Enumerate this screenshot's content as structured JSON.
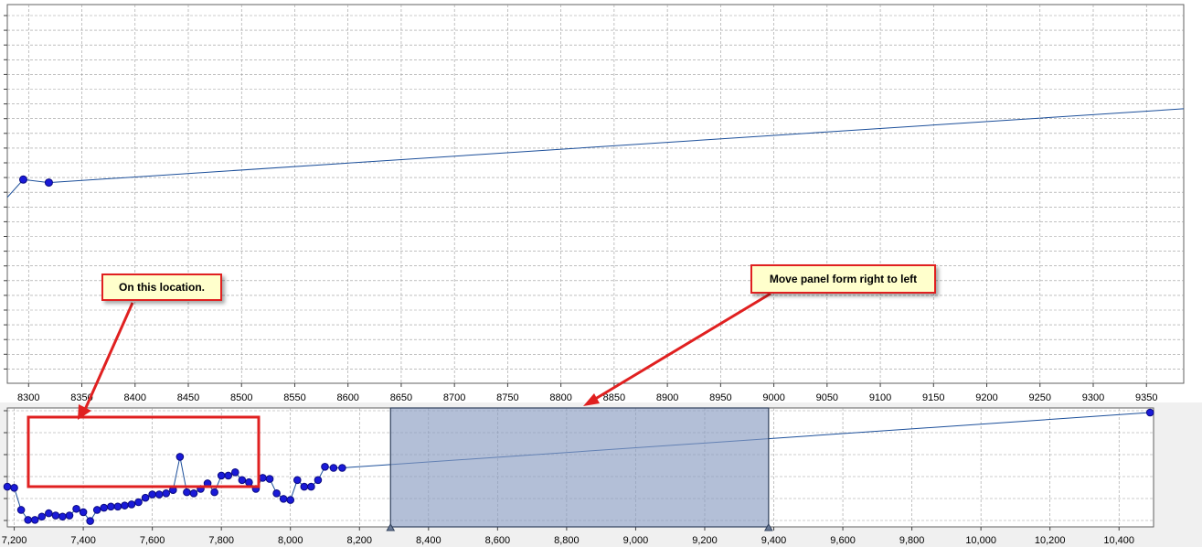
{
  "colors": {
    "series_line": "#1c4f9a",
    "marker_fill": "#1a1ad8",
    "marker_stroke": "#0a0a80",
    "grid": "#9a9a9a",
    "selection_fill": "#8a9cc2",
    "highlight_border": "#e02020",
    "callout_fill": "#ffffcc"
  },
  "callouts": {
    "location": "On this location.",
    "move": "Move panel form right to left"
  },
  "chart_data": [
    {
      "id": "main",
      "type": "line",
      "x_ticks": [
        8300,
        8350,
        8400,
        8450,
        8500,
        8550,
        8600,
        8650,
        8700,
        8750,
        8800,
        8850,
        8900,
        8950,
        9000,
        9050,
        9100,
        9150,
        9200,
        9250,
        9300,
        9350
      ],
      "x_tick_labels": [
        "8300",
        "8350",
        "8400",
        "8450",
        "8500",
        "8550",
        "8600",
        "8650",
        "8700",
        "8750",
        "8800",
        "8850",
        "8900",
        "8950",
        "9000",
        "9050",
        "9100",
        "9150",
        "9200",
        "9250",
        "9300",
        "9350"
      ],
      "xlim": [
        8280,
        9385
      ],
      "ylim": [
        0,
        100
      ],
      "grid": true,
      "series": [
        {
          "points": [
            [
              8270,
              46
            ],
            [
              8295,
              53.8
            ],
            [
              8319,
              53
            ]
          ],
          "line_end": [
            9385,
            72.5
          ],
          "markers": [
            [
              8295,
              53.8
            ],
            [
              8319,
              53
            ]
          ]
        }
      ]
    },
    {
      "id": "overview",
      "type": "line",
      "x_ticks": [
        7200,
        7400,
        7600,
        7800,
        8000,
        8200,
        8400,
        8600,
        8800,
        9000,
        9200,
        9400,
        9600,
        9800,
        10000,
        10200,
        10400
      ],
      "x_tick_labels": [
        "7,200",
        "7,400",
        "7,600",
        "7,800",
        "8,000",
        "8,200",
        "8,400",
        "8,600",
        "8,800",
        "9,000",
        "9,200",
        "9,400",
        "9,600",
        "9,800",
        "10,000",
        "10,200",
        "10,400"
      ],
      "xlim": [
        7180,
        10500
      ],
      "ylim": [
        0,
        100
      ],
      "grid": true,
      "selection_range": [
        8290,
        9385
      ],
      "series": [
        {
          "points": [
            [
              7180,
              33
            ],
            [
              7200,
              32
            ],
            [
              7220,
              12
            ],
            [
              7240,
              3
            ],
            [
              7260,
              3
            ],
            [
              7280,
              6
            ],
            [
              7300,
              9
            ],
            [
              7320,
              7
            ],
            [
              7340,
              6
            ],
            [
              7360,
              7
            ],
            [
              7380,
              13
            ],
            [
              7400,
              10
            ],
            [
              7420,
              2
            ],
            [
              7440,
              12
            ],
            [
              7460,
              14
            ],
            [
              7480,
              15
            ],
            [
              7500,
              15
            ],
            [
              7520,
              16
            ],
            [
              7540,
              17
            ],
            [
              7560,
              19
            ],
            [
              7580,
              23
            ],
            [
              7600,
              26
            ],
            [
              7620,
              26
            ],
            [
              7640,
              27
            ],
            [
              7660,
              30
            ],
            [
              7680,
              60
            ],
            [
              7700,
              28
            ],
            [
              7720,
              27
            ],
            [
              7740,
              31
            ],
            [
              7760,
              36
            ],
            [
              7780,
              28
            ],
            [
              7800,
              43
            ],
            [
              7820,
              43
            ],
            [
              7840,
              46
            ],
            [
              7860,
              39
            ],
            [
              7880,
              37
            ],
            [
              7900,
              31
            ],
            [
              7920,
              41
            ],
            [
              7940,
              40
            ],
            [
              7960,
              27
            ],
            [
              7980,
              22
            ],
            [
              8000,
              21
            ],
            [
              8020,
              39
            ],
            [
              8040,
              33
            ],
            [
              8060,
              33
            ],
            [
              8080,
              39
            ],
            [
              8100,
              51
            ],
            [
              8125,
              50
            ],
            [
              8150,
              50
            ],
            [
              10490,
              100
            ]
          ]
        }
      ]
    }
  ]
}
